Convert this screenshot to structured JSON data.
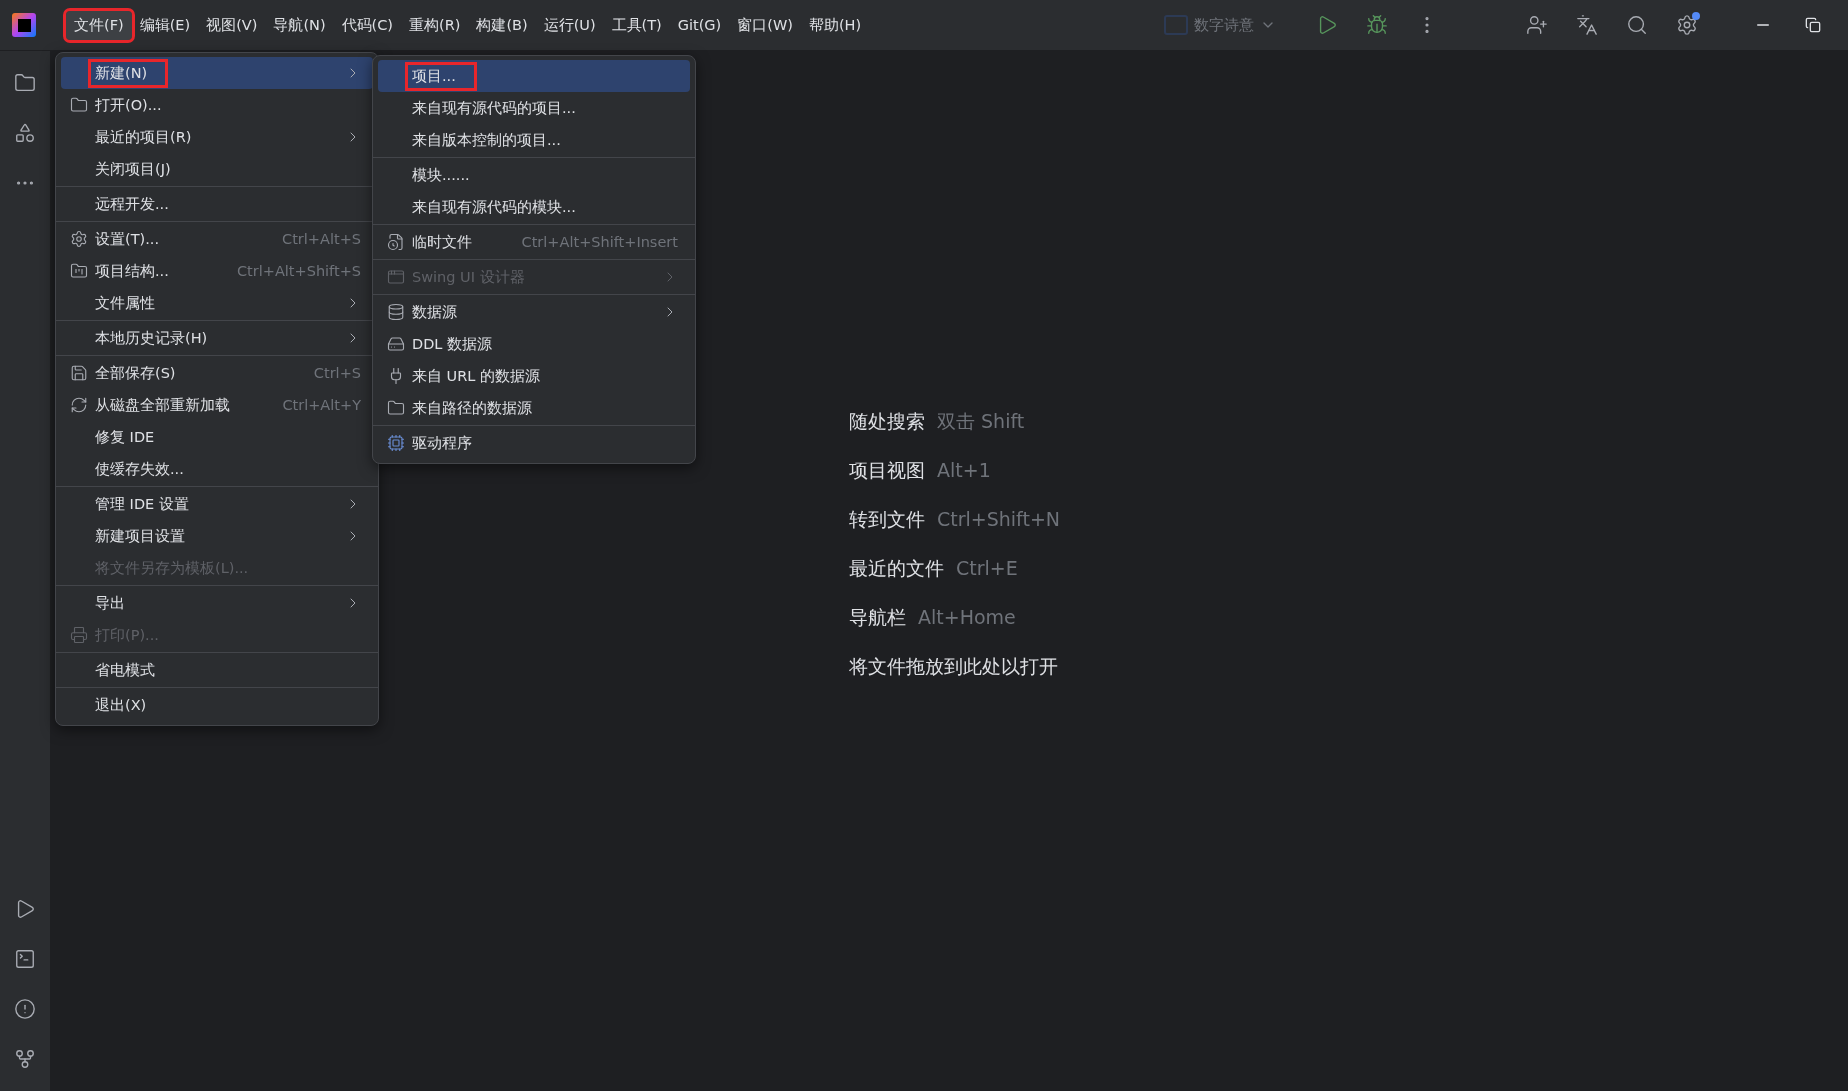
{
  "menubar": [
    {
      "label": "文件(F)",
      "selected": true,
      "highlighted": true
    },
    {
      "label": "编辑(E)",
      "selected": false,
      "highlighted": false
    },
    {
      "label": "视图(V)",
      "selected": false,
      "highlighted": false
    },
    {
      "label": "导航(N)",
      "selected": false,
      "highlighted": false
    },
    {
      "label": "代码(C)",
      "selected": false,
      "highlighted": false
    },
    {
      "label": "重构(R)",
      "selected": false,
      "highlighted": false
    },
    {
      "label": "构建(B)",
      "selected": false,
      "highlighted": false
    },
    {
      "label": "运行(U)",
      "selected": false,
      "highlighted": false
    },
    {
      "label": "工具(T)",
      "selected": false,
      "highlighted": false
    },
    {
      "label": "Git(G)",
      "selected": false,
      "highlighted": false
    },
    {
      "label": "窗口(W)",
      "selected": false,
      "highlighted": false
    },
    {
      "label": "帮助(H)",
      "selected": false,
      "highlighted": false
    }
  ],
  "run_config": {
    "label": "数字诗意"
  },
  "file_menu": [
    [
      {
        "label": "新建(N)",
        "submenu": true,
        "disabled": false,
        "selected": true,
        "highlighted": true
      },
      {
        "label": "打开(O)...",
        "submenu": false,
        "disabled": false,
        "selected": false,
        "highlighted": false
      },
      {
        "label": "最近的项目(R)",
        "submenu": true,
        "disabled": false,
        "selected": false,
        "highlighted": false
      },
      {
        "label": "关闭项目(J)",
        "submenu": false,
        "disabled": false,
        "selected": false,
        "highlighted": false
      }
    ],
    [
      {
        "label": "远程开发...",
        "submenu": false,
        "disabled": false,
        "selected": false,
        "highlighted": false
      }
    ],
    [
      {
        "label": "设置(T)...",
        "shortcut": "Ctrl+Alt+S",
        "submenu": false,
        "disabled": false,
        "selected": false,
        "highlighted": false
      },
      {
        "label": "项目结构...",
        "shortcut": "Ctrl+Alt+Shift+S",
        "submenu": false,
        "disabled": false,
        "selected": false,
        "highlighted": false
      },
      {
        "label": "文件属性",
        "submenu": true,
        "disabled": false,
        "selected": false,
        "highlighted": false
      }
    ],
    [
      {
        "label": "本地历史记录(H)",
        "submenu": true,
        "disabled": false,
        "selected": false,
        "highlighted": false
      }
    ],
    [
      {
        "label": "全部保存(S)",
        "shortcut": "Ctrl+S",
        "submenu": false,
        "disabled": false,
        "selected": false,
        "highlighted": false
      },
      {
        "label": "从磁盘全部重新加载",
        "shortcut": "Ctrl+Alt+Y",
        "submenu": false,
        "disabled": false,
        "selected": false,
        "highlighted": false
      },
      {
        "label": "修复 IDE",
        "submenu": false,
        "disabled": false,
        "selected": false,
        "highlighted": false
      },
      {
        "label": "使缓存失效...",
        "submenu": false,
        "disabled": false,
        "selected": false,
        "highlighted": false
      }
    ],
    [
      {
        "label": "管理 IDE 设置",
        "submenu": true,
        "disabled": false,
        "selected": false,
        "highlighted": false
      },
      {
        "label": "新建项目设置",
        "submenu": true,
        "disabled": false,
        "selected": false,
        "highlighted": false
      },
      {
        "label": "将文件另存为模板(L)...",
        "submenu": false,
        "disabled": true,
        "selected": false,
        "highlighted": false
      }
    ],
    [
      {
        "label": "导出",
        "submenu": true,
        "disabled": false,
        "selected": false,
        "highlighted": false
      },
      {
        "label": "打印(P)...",
        "submenu": false,
        "disabled": true,
        "selected": false,
        "highlighted": false
      }
    ],
    [
      {
        "label": "省电模式",
        "submenu": false,
        "disabled": false,
        "selected": false,
        "highlighted": false
      }
    ],
    [
      {
        "label": "退出(X)",
        "submenu": false,
        "disabled": false,
        "selected": false,
        "highlighted": false
      }
    ]
  ],
  "new_submenu": [
    [
      {
        "label": "项目...",
        "submenu": false,
        "disabled": false,
        "selected": true,
        "highlighted": true
      },
      {
        "label": "来自现有源代码的项目...",
        "submenu": false,
        "disabled": false,
        "selected": false,
        "highlighted": false
      },
      {
        "label": "来自版本控制的项目...",
        "submenu": false,
        "disabled": false,
        "selected": false,
        "highlighted": false
      }
    ],
    [
      {
        "label": "模块......",
        "submenu": false,
        "disabled": false,
        "selected": false,
        "highlighted": false
      },
      {
        "label": "来自现有源代码的模块...",
        "submenu": false,
        "disabled": false,
        "selected": false,
        "highlighted": false
      }
    ],
    [
      {
        "label": "临时文件",
        "shortcut": "Ctrl+Alt+Shift+Insert",
        "submenu": false,
        "disabled": false,
        "selected": false,
        "highlighted": false
      }
    ],
    [
      {
        "label": "Swing UI 设计器",
        "submenu": true,
        "disabled": true,
        "selected": false,
        "highlighted": false
      }
    ],
    [
      {
        "label": "数据源",
        "submenu": true,
        "disabled": false,
        "selected": false,
        "highlighted": false
      },
      {
        "label": "DDL 数据源",
        "submenu": false,
        "disabled": false,
        "selected": false,
        "highlighted": false
      },
      {
        "label": "来自 URL 的数据源",
        "submenu": false,
        "disabled": false,
        "selected": false,
        "highlighted": false
      },
      {
        "label": "来自路径的数据源",
        "submenu": false,
        "disabled": false,
        "selected": false,
        "highlighted": false
      }
    ],
    [
      {
        "label": "驱动程序",
        "submenu": false,
        "disabled": false,
        "selected": false,
        "highlighted": false
      }
    ]
  ],
  "hints": [
    {
      "action": "随处搜索",
      "shortcut": "双击 Shift"
    },
    {
      "action": "项目视图",
      "shortcut": "Alt+1"
    },
    {
      "action": "转到文件",
      "shortcut": "Ctrl+Shift+N"
    },
    {
      "action": "最近的文件",
      "shortcut": "Ctrl+E"
    },
    {
      "action": "导航栏",
      "shortcut": "Alt+Home"
    },
    {
      "action": "将文件拖放到此处以打开"
    }
  ]
}
